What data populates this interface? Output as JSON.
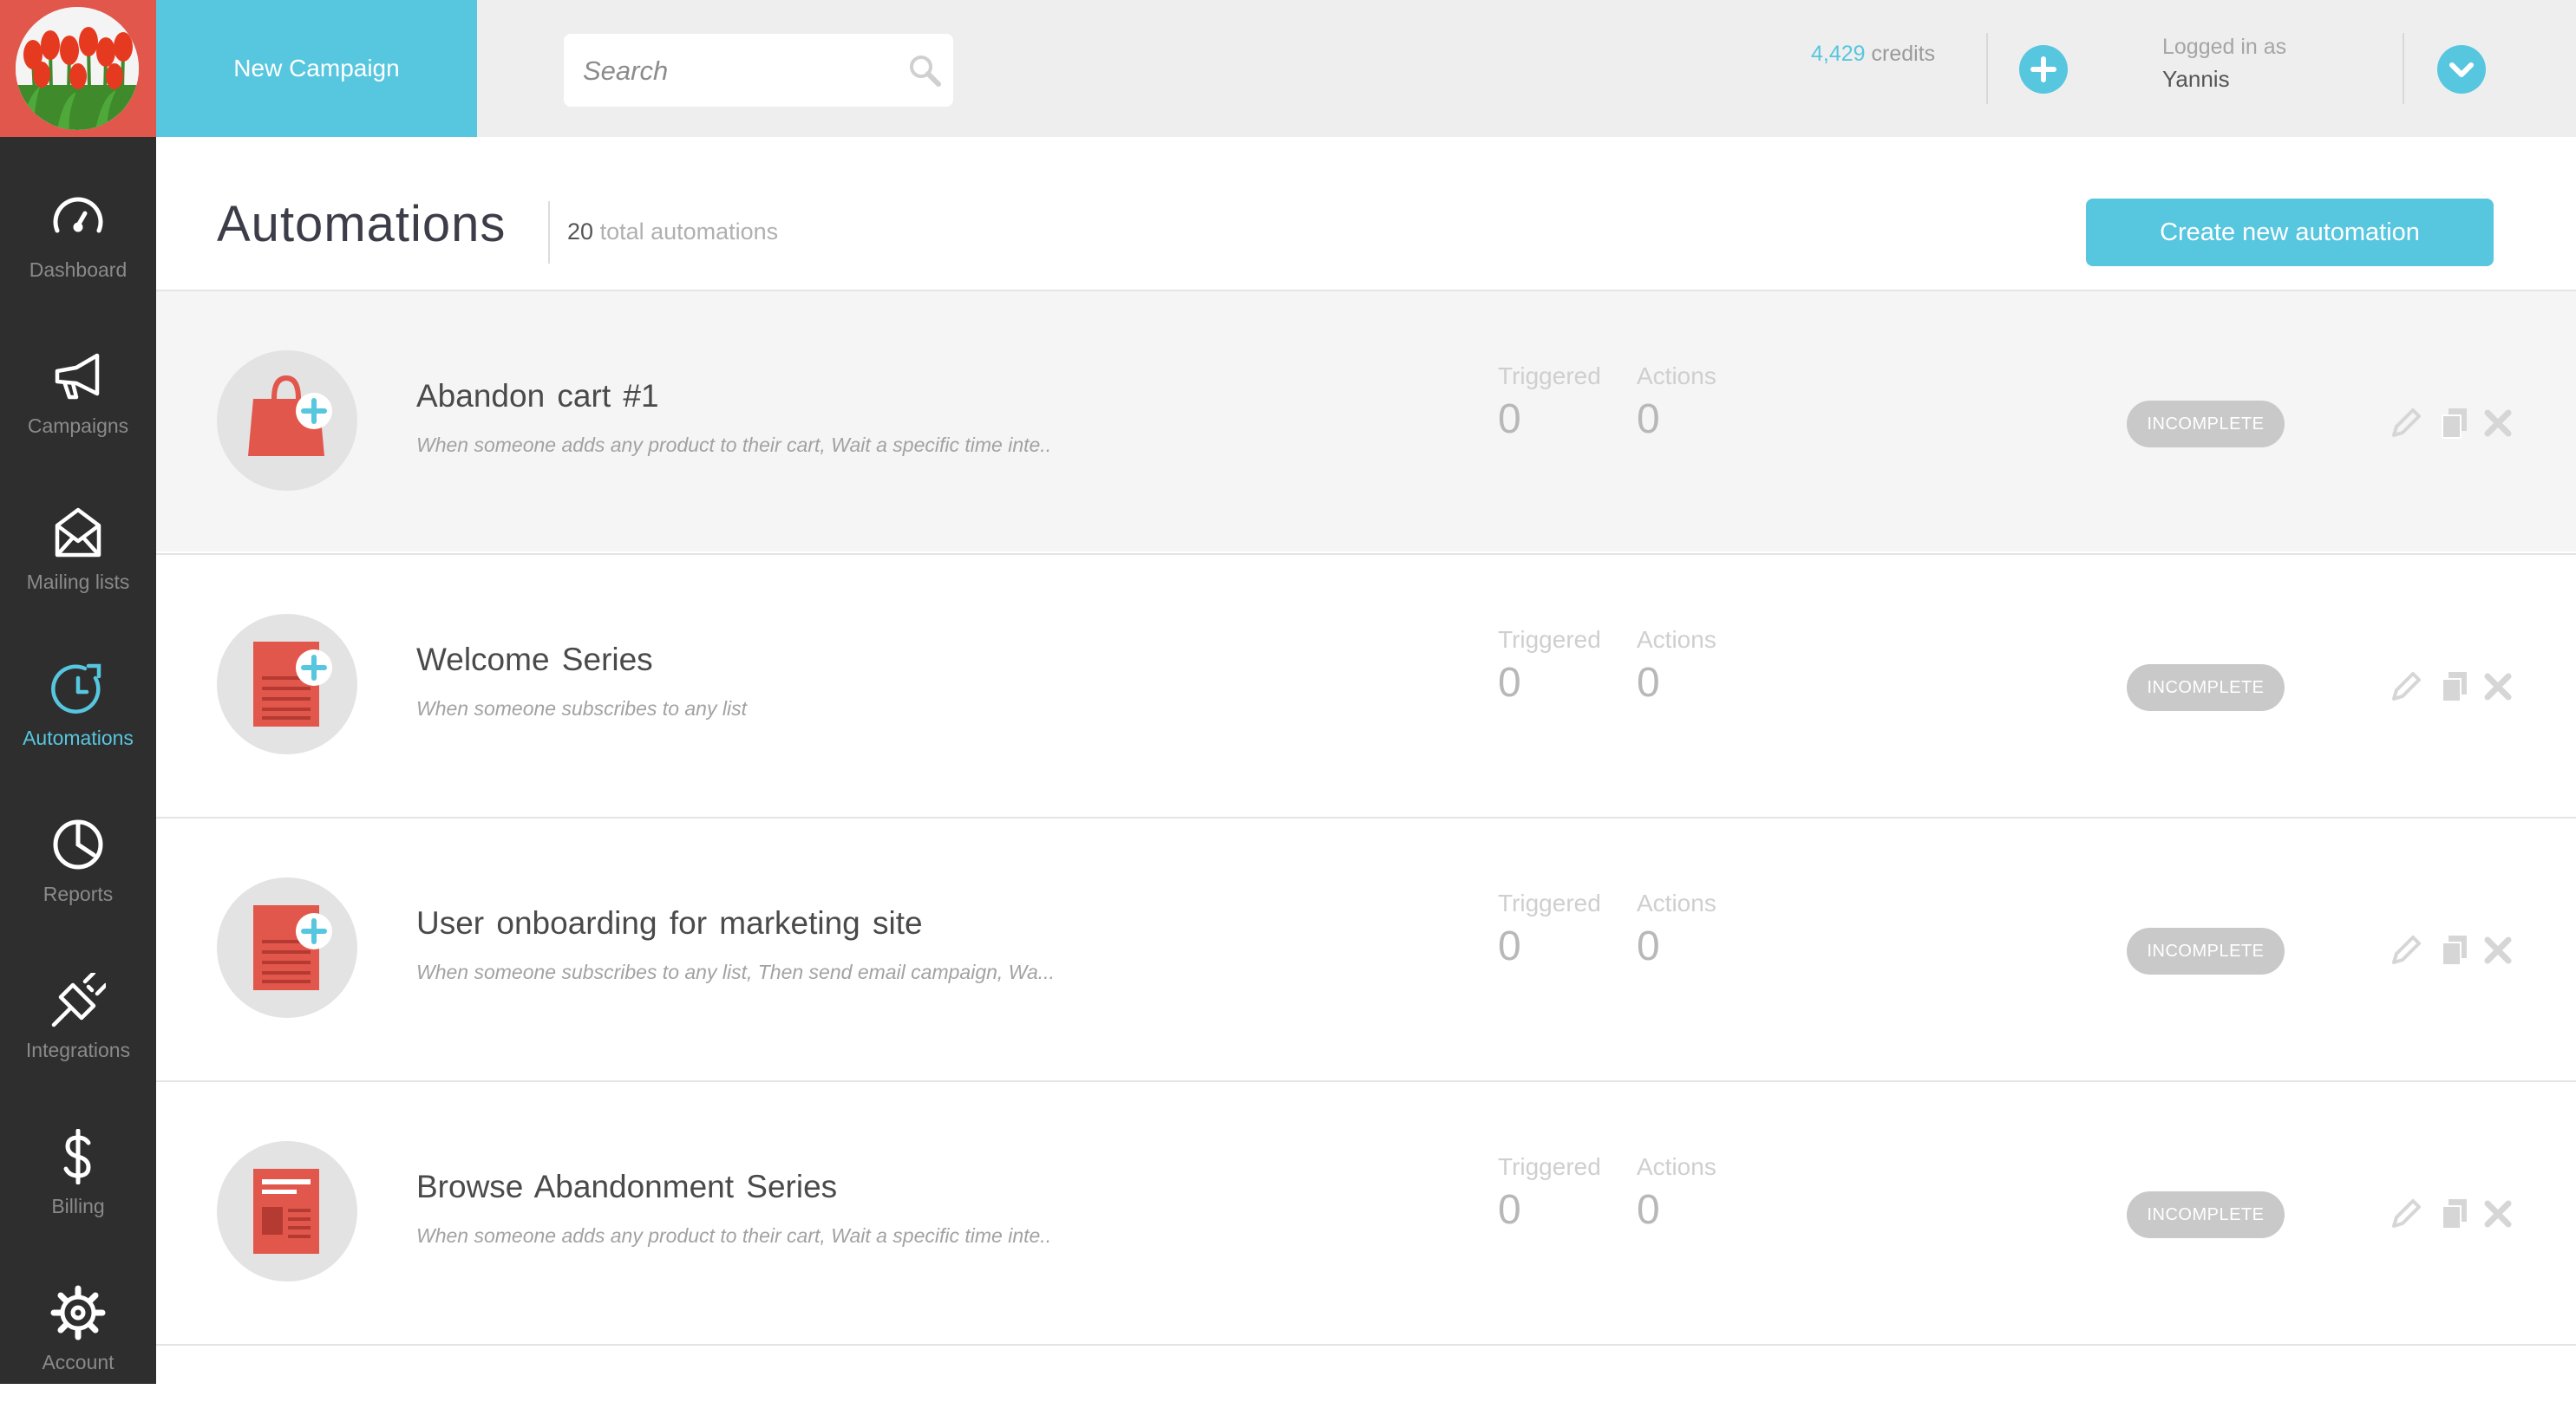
{
  "app": {
    "logo_icon": "tulips-logo",
    "accent_color": "#57c6df",
    "logo_bg_color": "#e2574c",
    "sidebar_bg_color": "#2e2e2e"
  },
  "sidebar": {
    "items": [
      {
        "label": "Dashboard",
        "icon": "speedometer-icon",
        "active": false
      },
      {
        "label": "Campaigns",
        "icon": "megaphone-icon",
        "active": false
      },
      {
        "label": "Mailing lists",
        "icon": "envelope-icon",
        "active": false
      },
      {
        "label": "Automations",
        "icon": "stopwatch-icon",
        "active": true
      },
      {
        "label": "Reports",
        "icon": "pie-chart-icon",
        "active": false
      },
      {
        "label": "Integrations",
        "icon": "plug-icon",
        "active": false
      },
      {
        "label": "Billing",
        "icon": "dollar-icon",
        "active": false
      },
      {
        "label": "Account",
        "icon": "gear-icon",
        "active": false
      }
    ]
  },
  "topbar": {
    "new_campaign_label": "New Campaign",
    "search_placeholder": "Search",
    "credits_amount": "4,429",
    "credits_label": "credits",
    "logged_in_label": "Logged in as",
    "user_name": "Yannis"
  },
  "page": {
    "title": "Automations",
    "total_count": "20",
    "total_label": "total automations",
    "create_button_label": "Create new automation"
  },
  "automations": [
    {
      "name": "Abandon cart #1",
      "description": "When someone adds any product to their cart, Wait a specific time inte..",
      "icon": "shopping-bag-add-icon",
      "triggered_label": "Triggered",
      "triggered": "0",
      "actions_label": "Actions",
      "actions": "0",
      "status": "INCOMPLETE"
    },
    {
      "name": "Welcome Series",
      "description": "When someone subscribes to any list",
      "icon": "document-add-icon",
      "triggered_label": "Triggered",
      "triggered": "0",
      "actions_label": "Actions",
      "actions": "0",
      "status": "INCOMPLETE"
    },
    {
      "name": "User onboarding for marketing site",
      "description": "When someone subscribes to any list, Then send email campaign, Wa...",
      "icon": "document-add-icon",
      "triggered_label": "Triggered",
      "triggered": "0",
      "actions_label": "Actions",
      "actions": "0",
      "status": "INCOMPLETE"
    },
    {
      "name": "Browse Abandonment Series",
      "description": "When someone adds any product to their cart, Wait a specific time inte..",
      "icon": "newsletter-icon",
      "triggered_label": "Triggered",
      "triggered": "0",
      "actions_label": "Actions",
      "actions": "0",
      "status": "INCOMPLETE"
    }
  ]
}
